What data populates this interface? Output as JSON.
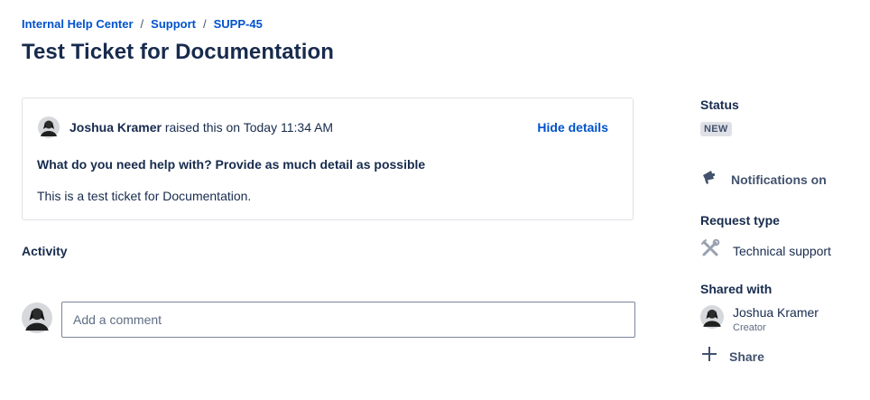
{
  "breadcrumb": {
    "items": [
      "Internal Help Center",
      "Support",
      "SUPP-45"
    ],
    "separator": "/"
  },
  "page": {
    "title": "Test Ticket for Documentation"
  },
  "request_details": {
    "author": "Joshua Kramer",
    "raised_text": "raised this on Today 11:34 AM",
    "hide_details_label": "Hide details",
    "field_label": "What do you need help with? Provide as much detail as possible",
    "field_value": "This is a test ticket for Documentation."
  },
  "activity": {
    "title": "Activity",
    "comment_placeholder": "Add a comment"
  },
  "sidebar": {
    "status_label": "Status",
    "status_value": "NEW",
    "notifications_label": "Notifications on",
    "request_type_label": "Request type",
    "request_type_value": "Technical support",
    "shared_with_label": "Shared with",
    "shared_user_name": "Joshua Kramer",
    "shared_user_role": "Creator",
    "share_label": "Share"
  },
  "icons": {
    "notifications": "megaphone-icon",
    "request_type": "tools-icon",
    "share": "plus-icon",
    "avatar": "user-avatar"
  },
  "colors": {
    "link": "#0052cc",
    "text": "#172b4d",
    "muted": "#42526e",
    "badge_bg": "#dfe1e6"
  }
}
